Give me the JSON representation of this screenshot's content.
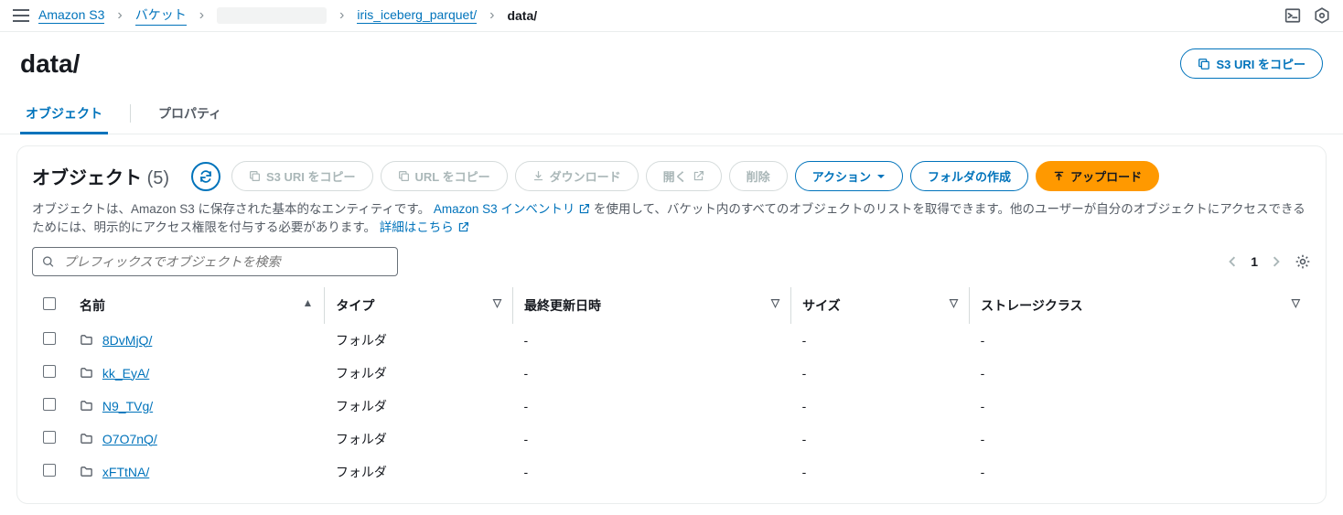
{
  "breadcrumbs": {
    "service": "Amazon S3",
    "buckets": "バケット",
    "prefix": "iris_iceberg_parquet/",
    "current": "data/"
  },
  "header": {
    "title": "data/",
    "copy_s3_uri": "S3 URI をコピー"
  },
  "tabs": {
    "objects": "オブジェクト",
    "properties": "プロパティ"
  },
  "panel": {
    "title": "オブジェクト",
    "count": "(5)",
    "buttons": {
      "copy_s3_uri": "S3 URI をコピー",
      "copy_url": "URL をコピー",
      "download": "ダウンロード",
      "open": "開く",
      "delete": "削除",
      "actions": "アクション",
      "create_folder": "フォルダの作成",
      "upload": "アップロード"
    },
    "description": {
      "pre": "オブジェクトは、Amazon S3 に保存された基本的なエンティティです。",
      "inventory_link": "Amazon S3 インベントリ",
      "mid": "を使用して、バケット内のすべてのオブジェクトのリストを取得できます。他のユーザーが自分のオブジェクトにアクセスできるためには、明示的にアクセス権限を付与する必要があります。",
      "learn_more": "詳細はこちら"
    }
  },
  "search": {
    "placeholder": "プレフィックスでオブジェクトを検索"
  },
  "pagination": {
    "page": "1"
  },
  "table": {
    "columns": {
      "name": "名前",
      "type": "タイプ",
      "last_modified": "最終更新日時",
      "size": "サイズ",
      "storage_class": "ストレージクラス"
    },
    "rows": [
      {
        "name": "8DvMjQ/",
        "type": "フォルダ",
        "last_modified": "-",
        "size": "-",
        "storage_class": "-"
      },
      {
        "name": "kk_EyA/",
        "type": "フォルダ",
        "last_modified": "-",
        "size": "-",
        "storage_class": "-"
      },
      {
        "name": "N9_TVg/",
        "type": "フォルダ",
        "last_modified": "-",
        "size": "-",
        "storage_class": "-"
      },
      {
        "name": "O7O7nQ/",
        "type": "フォルダ",
        "last_modified": "-",
        "size": "-",
        "storage_class": "-"
      },
      {
        "name": "xFTtNA/",
        "type": "フォルダ",
        "last_modified": "-",
        "size": "-",
        "storage_class": "-"
      }
    ]
  }
}
